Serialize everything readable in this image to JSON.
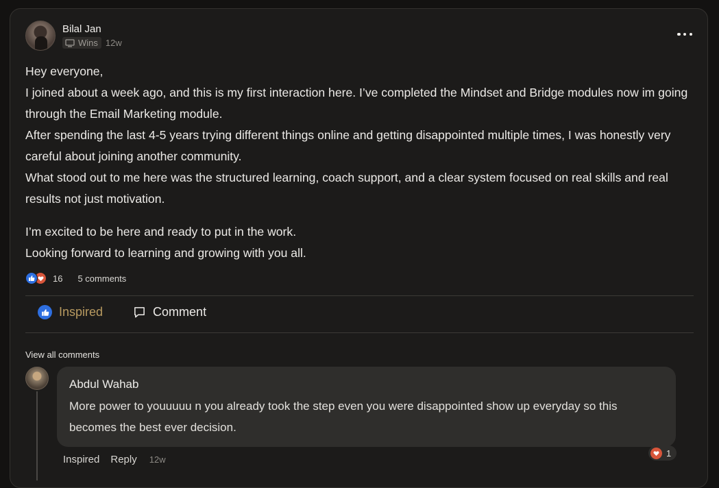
{
  "post": {
    "author": "Bilal Jan",
    "category": "Wins",
    "time": "12w",
    "body_lines": [
      "Hey everyone,",
      "I joined about a week ago, and this is my first interaction here. I’ve completed the Mindset and Bridge modules now im going through the Email Marketing module.",
      "After spending the last 4-5 years trying different things online and getting disappointed multiple times, I was honestly very careful about joining another community.",
      "What stood out to me here was the structured learning, coach support, and a clear system focused on real skills and real results not just motivation."
    ],
    "body_lines_2": [
      "I’m excited to be here and ready to put in the work.",
      "Looking forward to learning and growing with you all."
    ],
    "reaction_count": "16",
    "comments_count": "5 comments"
  },
  "actions": {
    "inspired": "Inspired",
    "comment": "Comment"
  },
  "comments": {
    "view_all": "View all comments",
    "items": [
      {
        "author": "Abdul Wahab",
        "text": "More power to youuuuu n you already took the step even you were disappointed show up everyday so this becomes the best ever decision.",
        "action_inspired": "Inspired",
        "action_reply": "Reply",
        "time": "12w",
        "reaction_count": "1"
      }
    ]
  },
  "colors": {
    "background": "#131211",
    "card": "#1c1b1a",
    "accent_inspired": "#b89a60",
    "like_blue": "#2e6fe0",
    "heart_red": "#d8553a"
  },
  "icons": [
    "more-dots-icon",
    "monitor-icon",
    "thumbs-up-icon",
    "heart-icon",
    "comment-bubble-icon"
  ]
}
